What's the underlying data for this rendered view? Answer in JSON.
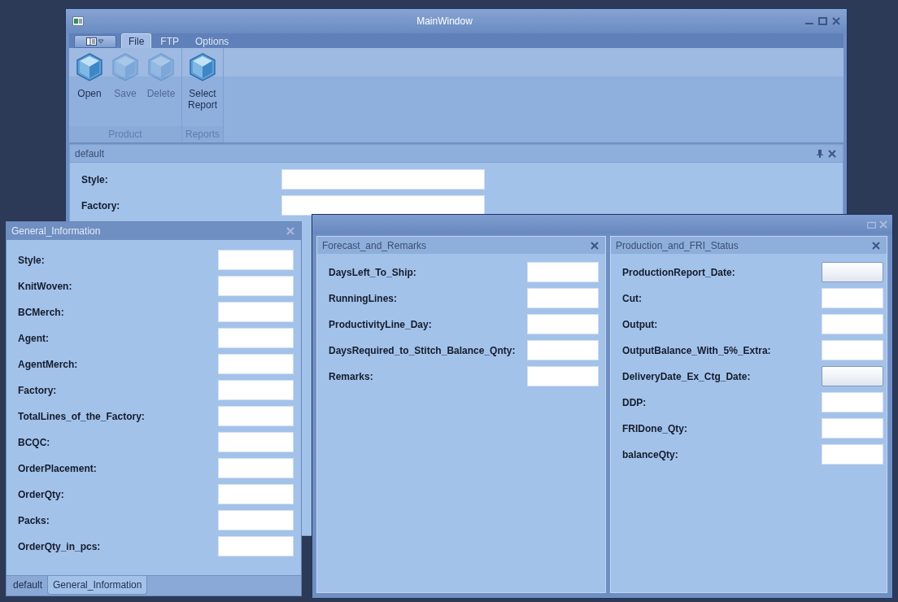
{
  "main_window": {
    "title": "MainWindow",
    "ribbon_tabs": [
      {
        "label": "File",
        "selected": true
      },
      {
        "label": "FTP",
        "selected": false
      },
      {
        "label": "Options",
        "selected": false
      }
    ],
    "ribbon_groups": [
      {
        "label": "Product",
        "buttons": [
          {
            "label": "Open",
            "disabled": false
          },
          {
            "label": "Save",
            "disabled": true
          },
          {
            "label": "Delete",
            "disabled": true
          }
        ]
      },
      {
        "label": "Reports",
        "buttons": [
          {
            "label": "Select Report",
            "disabled": false
          }
        ]
      }
    ],
    "panel": {
      "title": "default",
      "fields": [
        {
          "label": "Style:"
        },
        {
          "label": "Factory:"
        }
      ]
    }
  },
  "general_window": {
    "title": "General_Information",
    "fields": [
      {
        "label": "Style:"
      },
      {
        "label": "KnitWoven:"
      },
      {
        "label": "BCMerch:"
      },
      {
        "label": "Agent:"
      },
      {
        "label": "AgentMerch:"
      },
      {
        "label": "Factory:"
      },
      {
        "label": "TotalLines_of_the_Factory:"
      },
      {
        "label": "BCQC:"
      },
      {
        "label": "OrderPlacement:"
      },
      {
        "label": "OrderQty:"
      },
      {
        "label": "Packs:"
      },
      {
        "label": "OrderQty_in_pcs:"
      }
    ],
    "tabs": [
      {
        "label": "default",
        "selected": false
      },
      {
        "label": "General_Information",
        "selected": true
      }
    ]
  },
  "float_window": {
    "panels": [
      {
        "title": "Forecast_and_Remarks",
        "fields": [
          {
            "label": "DaysLeft_To_Ship:"
          },
          {
            "label": "RunningLines:"
          },
          {
            "label": "ProductivityLine_Day:"
          },
          {
            "label": "DaysRequired_to_Stitch_Balance_Qnty:"
          },
          {
            "label": "Remarks:"
          }
        ]
      },
      {
        "title": "Production_and_FRI_Status",
        "fields": [
          {
            "label": "ProductionReport_Date:",
            "kind": "date"
          },
          {
            "label": "Cut:",
            "kind": "text"
          },
          {
            "label": "Output:",
            "kind": "text"
          },
          {
            "label": "OutputBalance_With_5%_Extra:",
            "kind": "text"
          },
          {
            "label": "DeliveryDate_Ex_Ctg_Date:",
            "kind": "date"
          },
          {
            "label": "DDP:",
            "kind": "text"
          },
          {
            "label": "FRIDone_Qty:",
            "kind": "text"
          },
          {
            "label": "balanceQty:",
            "kind": "text"
          }
        ]
      }
    ]
  }
}
